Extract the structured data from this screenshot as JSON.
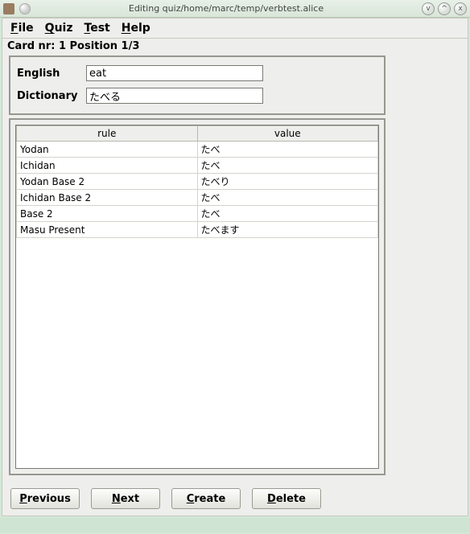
{
  "titlebar": {
    "title": "Editing quiz/home/marc/temp/verbtest.alice",
    "minimize": "v",
    "maximize": "^",
    "close": "x"
  },
  "menu": {
    "file": "File",
    "quiz": "Quiz",
    "test": "Test",
    "help": "Help"
  },
  "status": "Card nr: 1 Position 1/3",
  "form": {
    "english_label": "English",
    "english_value": "eat",
    "dictionary_label": "Dictionary",
    "dictionary_value": "たべる"
  },
  "table": {
    "headers": {
      "rule": "rule",
      "value": "value"
    },
    "rows": [
      {
        "rule": "Yodan",
        "value": "たべ"
      },
      {
        "rule": "Ichidan",
        "value": "たべ"
      },
      {
        "rule": "Yodan Base 2",
        "value": "たべり"
      },
      {
        "rule": "Ichidan Base 2",
        "value": "たべ"
      },
      {
        "rule": "Base 2",
        "value": "たべ"
      },
      {
        "rule": "Masu Present",
        "value": "たべます"
      }
    ]
  },
  "buttons": {
    "previous": "Previous",
    "next": "Next",
    "create": "Create",
    "delete": "Delete"
  },
  "footer": {
    "left": "",
    "right": ""
  }
}
